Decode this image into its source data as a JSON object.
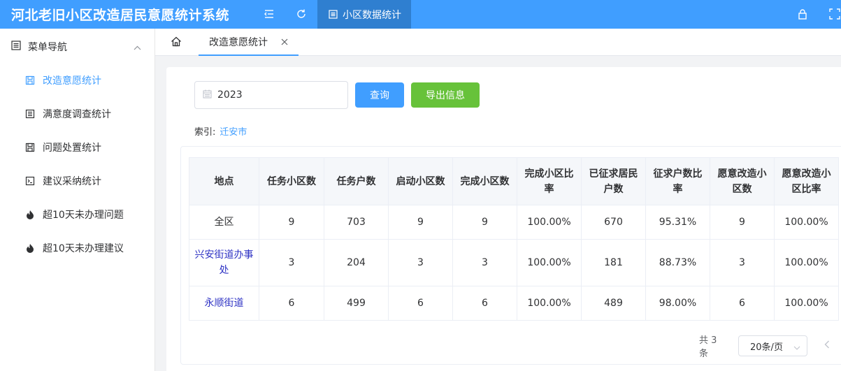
{
  "app": {
    "title": "河北老旧小区改造居民意愿统计系统",
    "header_tab": "小区数据统计"
  },
  "sidebar": {
    "heading": "菜单导航",
    "items": [
      {
        "label": "改造意愿统计",
        "icon": "save-icon",
        "active": true
      },
      {
        "label": "满意度调查统计",
        "icon": "list-icon",
        "active": false
      },
      {
        "label": "问题处置统计",
        "icon": "save-icon",
        "active": false
      },
      {
        "label": "建议采纳统计",
        "icon": "terminal-icon",
        "active": false
      },
      {
        "label": "超10天未办理问题",
        "icon": "flame-icon",
        "active": false
      },
      {
        "label": "超10天未办理建议",
        "icon": "flame-icon",
        "active": false
      }
    ]
  },
  "tabs": {
    "home_icon": "home-icon",
    "current": "改造意愿统计"
  },
  "filter": {
    "year": "2023",
    "query_label": "查询",
    "export_label": "导出信息",
    "index_label": "索引:",
    "index_link": "迁安市"
  },
  "table": {
    "headers": [
      "地点",
      "任务小区数",
      "任务户数",
      "启动小区数",
      "完成小区数",
      "完成小区比率",
      "已征求居民户数",
      "征求户数比率",
      "愿意改造小区数",
      "愿意改造小区比率"
    ],
    "rows": [
      [
        "全区",
        "9",
        "703",
        "9",
        "9",
        "100.00%",
        "670",
        "95.31%",
        "9",
        "100.00%"
      ],
      [
        "兴安街道办事处",
        "3",
        "204",
        "3",
        "3",
        "100.00%",
        "181",
        "88.73%",
        "3",
        "100.00%"
      ],
      [
        "永顺街道",
        "6",
        "499",
        "6",
        "6",
        "100.00%",
        "489",
        "98.00%",
        "6",
        "100.00%"
      ]
    ]
  },
  "pagination": {
    "total": "共 3 条",
    "page_size": "20条/页"
  },
  "colors": {
    "primary": "#409eff",
    "success": "#67c23a",
    "link_dark": "#2f33c4"
  }
}
